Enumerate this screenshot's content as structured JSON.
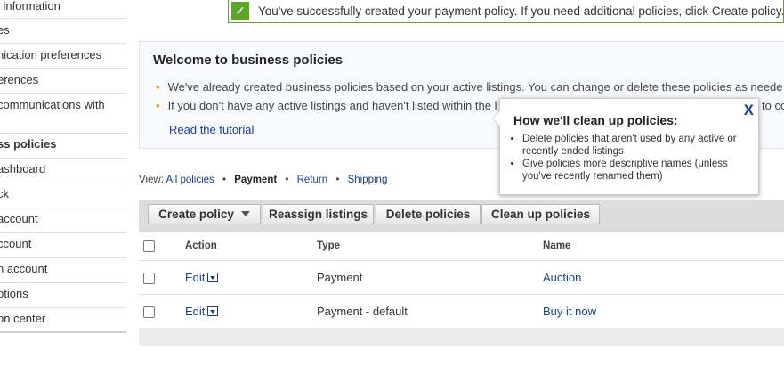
{
  "sidebar": {
    "items": [
      {
        "label": "l information",
        "selected": false
      },
      {
        "label": "es",
        "selected": false
      },
      {
        "label": "nication preferences",
        "selected": false
      },
      {
        "label": "erences",
        "selected": false
      },
      {
        "label": " communications with",
        "label2": "",
        "selected": false
      },
      {
        "label": "ss policies",
        "selected": true
      },
      {
        "label": "ashboard",
        "selected": false
      },
      {
        "label": "ck",
        "selected": false
      },
      {
        "label": "account",
        "selected": false
      },
      {
        "label": "ccount",
        "selected": false
      },
      {
        "label": "n account",
        "selected": false
      },
      {
        "label": "otions",
        "selected": false
      },
      {
        "label": "on center",
        "selected": false
      }
    ]
  },
  "success": {
    "message": "You've successfully created your payment policy. If you need additional policies, click Create policy.",
    "icon": "checkmark-icon",
    "color": "#5ba829"
  },
  "welcome": {
    "title": "Welcome to business policies",
    "bullet1": "We've already created business policies based on your active listings. You can change or delete these policies as neede",
    "bullet2": "If you don't have any active listings and haven't listed within the l",
    "bullet2_tail": "to co",
    "tutorial_link": "Read the tutorial"
  },
  "view": {
    "label": "View:",
    "all": "All policies",
    "payment": "Payment",
    "return": "Return",
    "shipping": "Shipping"
  },
  "toolbar": {
    "create": "Create policy",
    "reassign": "Reassign listings",
    "delete": "Delete policies",
    "cleanup": "Clean up policies"
  },
  "table": {
    "headers": {
      "action": "Action",
      "type": "Type",
      "name": "Name"
    },
    "rows": [
      {
        "action": "Edit",
        "type": "Payment",
        "name": "Auction"
      },
      {
        "action": "Edit",
        "type": "Payment - default",
        "name": "Buy it now"
      }
    ]
  },
  "popup": {
    "title": "How we'll clean up policies:",
    "close": "X",
    "item1": "Delete policies that aren't used by any active or recently ended listings",
    "item2": "Give policies more descriptive names (unless you've recently renamed them)"
  },
  "colors": {
    "link": "#1a3f8a",
    "bullet": "#e89400",
    "success": "#5ba829"
  }
}
